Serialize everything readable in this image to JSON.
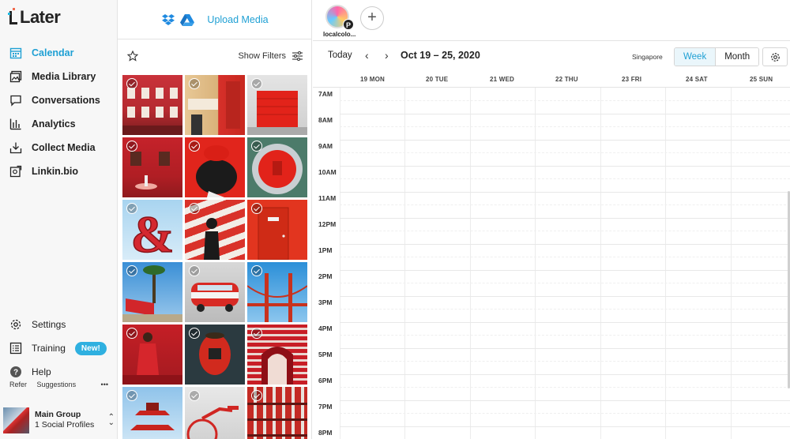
{
  "brand": {
    "name": "Later"
  },
  "sidebar": {
    "items": [
      {
        "label": "Calendar",
        "icon": "calendar-icon",
        "active": true
      },
      {
        "label": "Media Library",
        "icon": "image-icon"
      },
      {
        "label": "Conversations",
        "icon": "chat-icon"
      },
      {
        "label": "Analytics",
        "icon": "bar-chart-icon"
      },
      {
        "label": "Collect Media",
        "icon": "download-icon"
      },
      {
        "label": "Linkin.bio",
        "icon": "link-icon"
      }
    ],
    "bottom_items": [
      {
        "label": "Settings",
        "icon": "gear-icon"
      },
      {
        "label": "Training",
        "icon": "checklist-icon",
        "badge": "New!"
      },
      {
        "label": "Help",
        "icon": "help-icon"
      }
    ],
    "refer": "Refer",
    "suggestions": "Suggestions",
    "more": "•••",
    "group": {
      "name": "Main Group",
      "profiles": "1 Social Profiles"
    }
  },
  "media": {
    "upload_label": "Upload Media",
    "show_filters": "Show Filters"
  },
  "topbar": {
    "profile_name": "localcolo...",
    "profile_network": "P"
  },
  "calendar": {
    "today": "Today",
    "range": "Oct 19 – 25, 2020",
    "timezone": "Singapore",
    "view_week": "Week",
    "view_month": "Month",
    "days": [
      "19 MON",
      "20 TUE",
      "21 WED",
      "22 THU",
      "23 FRI",
      "24 SAT",
      "25 SUN"
    ],
    "hours": [
      "7AM",
      "8AM",
      "9AM",
      "10AM",
      "11AM",
      "12PM",
      "1PM",
      "2PM",
      "3PM",
      "4PM",
      "5PM",
      "6PM",
      "7PM",
      "8PM"
    ]
  },
  "colors": {
    "accent": "#1fa0d4",
    "badge": "#2fb0e0"
  }
}
